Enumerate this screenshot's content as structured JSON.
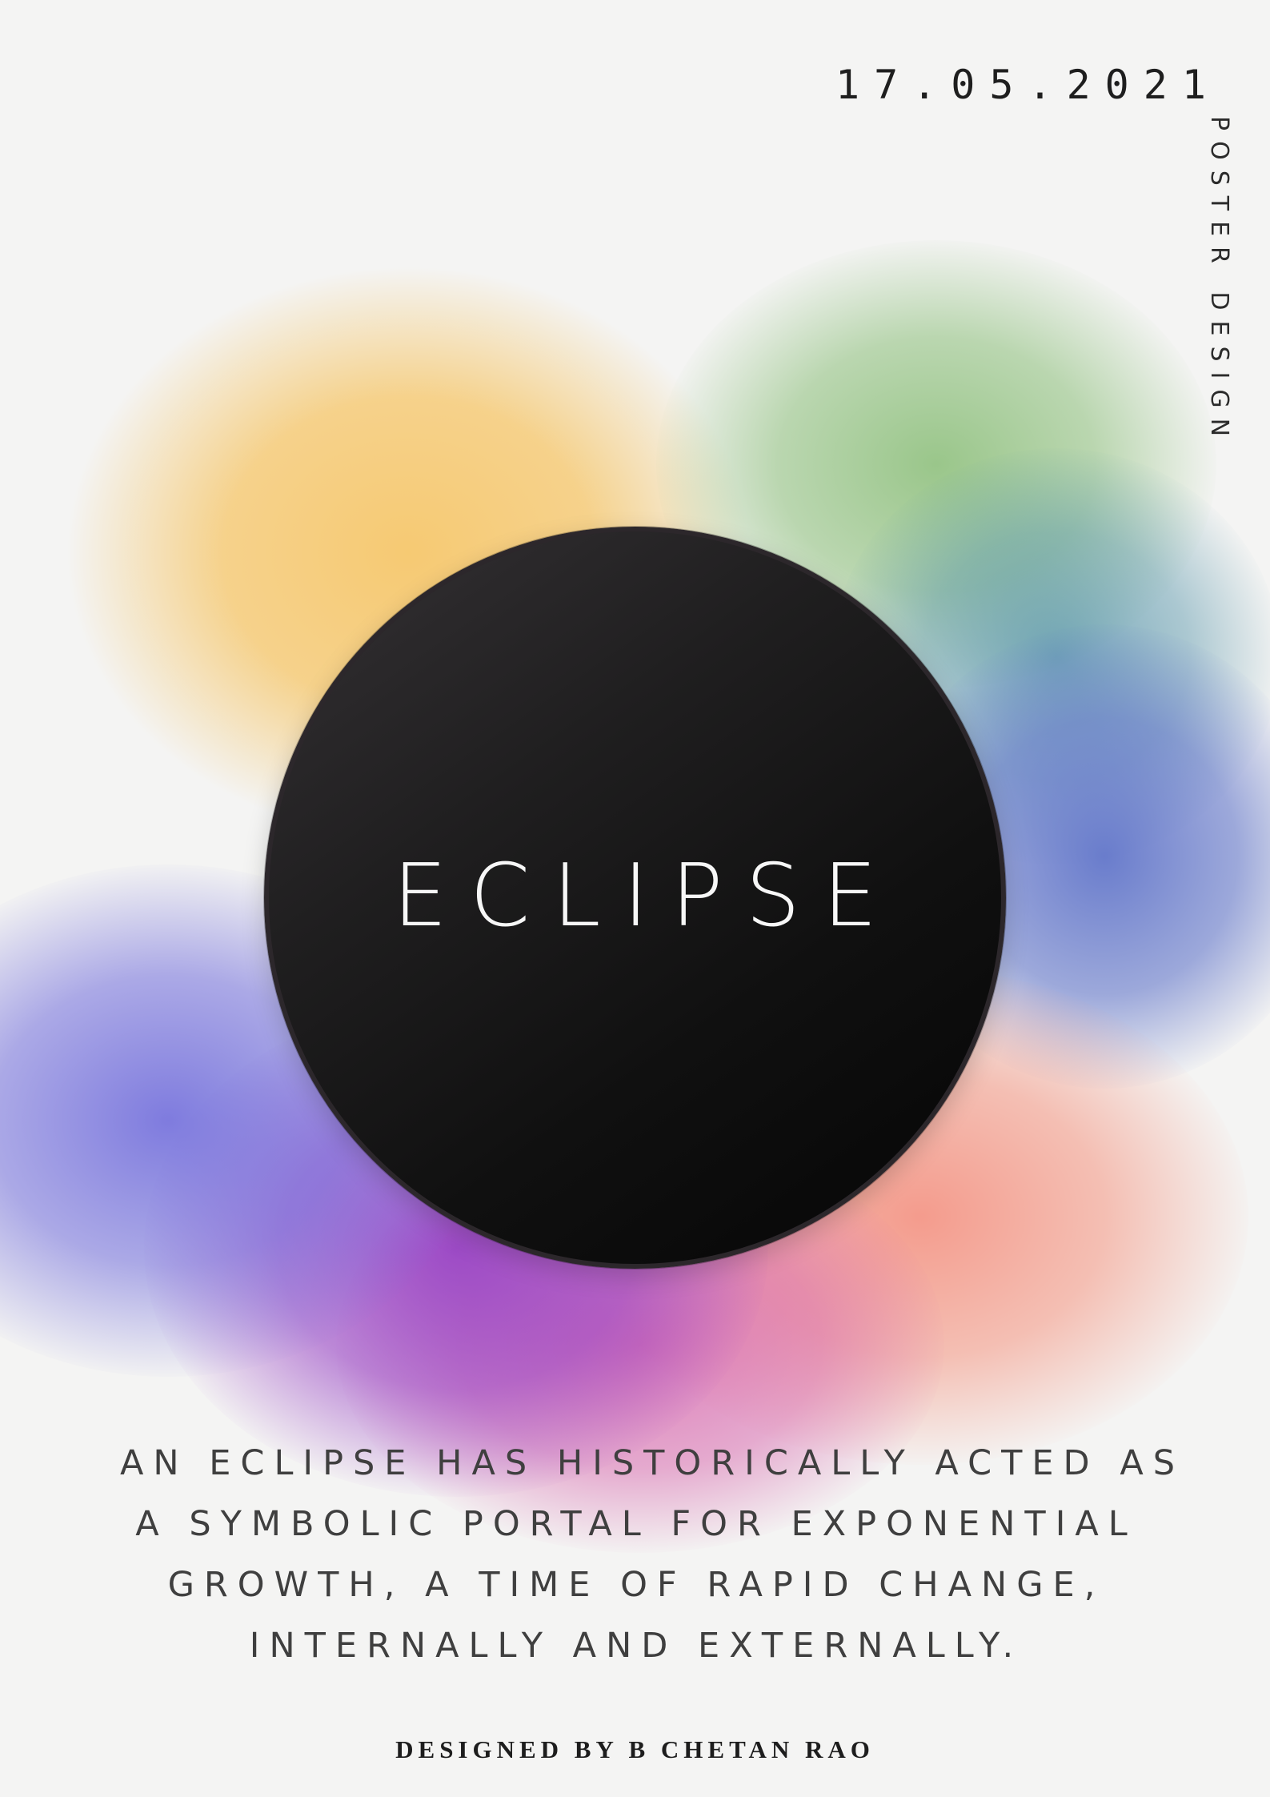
{
  "poster": {
    "date": "17.05.2021",
    "vertical_label": "POSTER DESIGN",
    "title": "ECLIPSE",
    "description_lines": [
      "AN ECLIPSE HAS HISTORICALLY ACTED AS",
      "A SYMBOLIC PORTAL FOR EXPONENTIAL",
      "GROWTH, A TIME OF RAPID CHANGE,",
      "INTERNALLY AND EXTERNALLY."
    ],
    "credit": "DESIGNED BY B CHETAN RAO"
  },
  "colors": {
    "background": "#f4f4f3",
    "eclipse": "#101010",
    "yellow": "#f6c668",
    "green": "#8abe78",
    "blue": "#6276ca",
    "salmon": "#f49282",
    "violet": "#9640c4"
  }
}
